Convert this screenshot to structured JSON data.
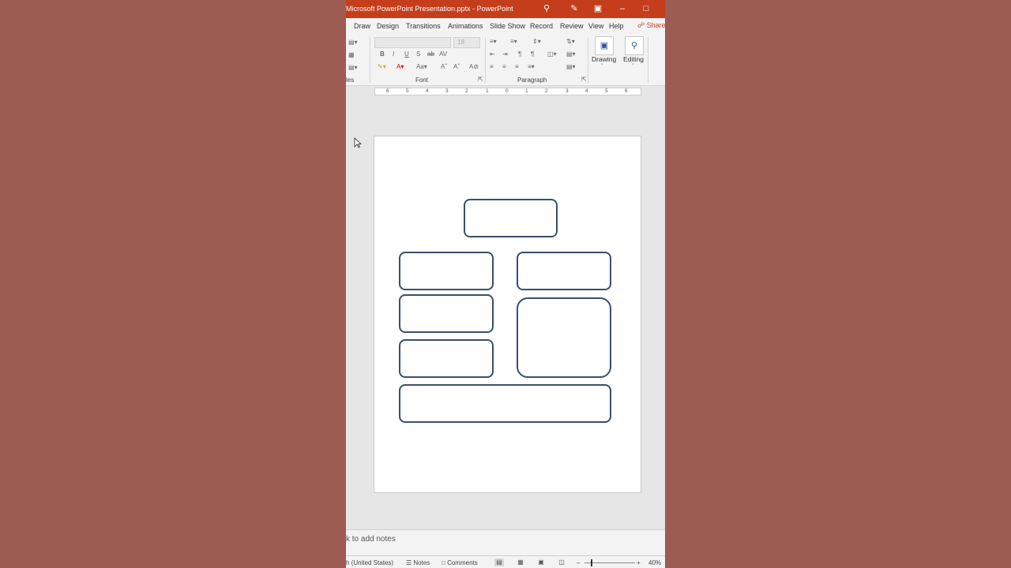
{
  "window": {
    "title": "Microsoft PowerPoint Presentation.pptx  -  PowerPoint",
    "title_icons": [
      "search-icon",
      "pen-icon",
      "ribbon-display-icon",
      "minimize-icon",
      "maximize-icon"
    ]
  },
  "tabs": {
    "items": [
      "Draw",
      "Design",
      "Transitions",
      "Animations",
      "Slide Show",
      "Record",
      "Review",
      "View",
      "Help"
    ],
    "share_label": "Share"
  },
  "ribbon": {
    "partial_group_label": "les",
    "font_group_label": "Font",
    "paragraph_group_label": "Paragraph",
    "font_size_value": "18",
    "font_buttons": [
      "B",
      "I",
      "U",
      "S",
      "ab",
      "AV"
    ],
    "drawing_label": "Drawing",
    "editing_label": "Editing"
  },
  "ruler": {
    "ticks": [
      "6",
      "5",
      "4",
      "3",
      "2",
      "1",
      "0",
      "1",
      "2",
      "3",
      "4",
      "5",
      "6"
    ]
  },
  "notes": {
    "placeholder": "k to add notes"
  },
  "status": {
    "language": "h (United States)",
    "notes_label": "Notes",
    "comments_label": "Comments",
    "zoom": "40%"
  },
  "colors": {
    "titlebar": "#c43e1c",
    "shape_border": "#3b4f6b",
    "background": "#9c5c52"
  }
}
